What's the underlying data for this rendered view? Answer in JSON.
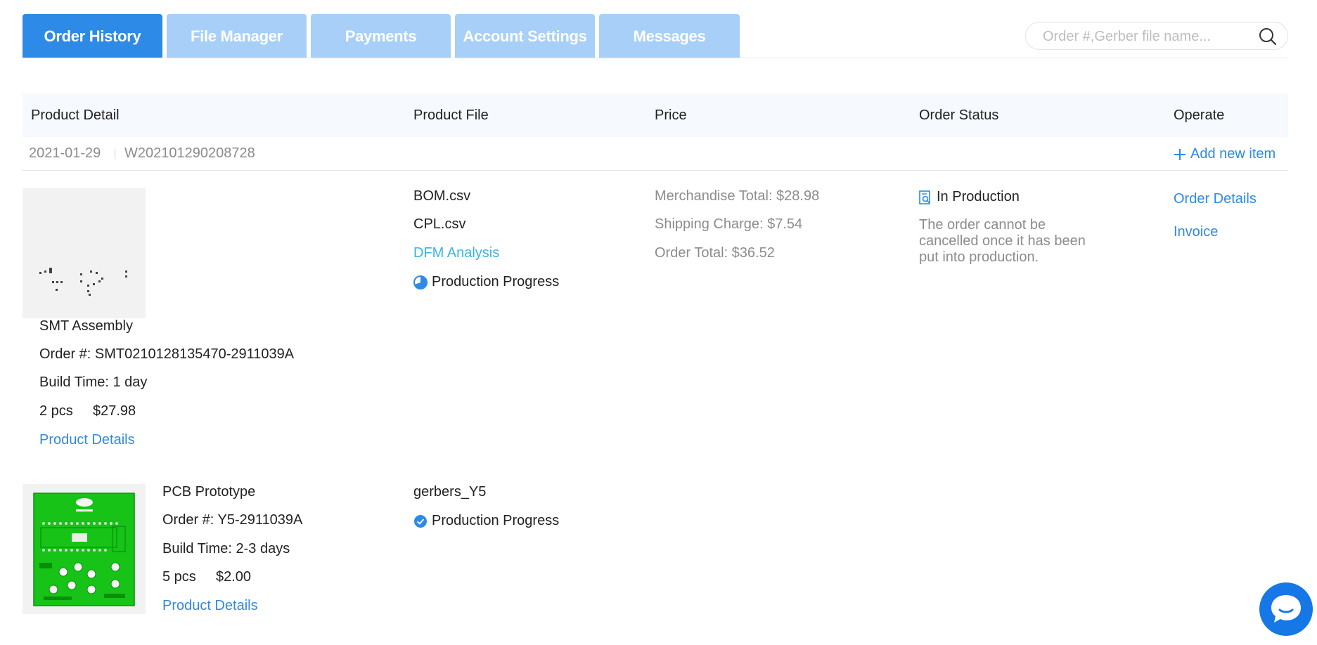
{
  "tabs": [
    {
      "label": "Order History",
      "active": true
    },
    {
      "label": "File Manager",
      "active": false
    },
    {
      "label": "Payments",
      "active": false
    },
    {
      "label": "Account Settings",
      "active": false
    },
    {
      "label": "Messages",
      "active": false
    }
  ],
  "search": {
    "placeholder": "Order #,Gerber file name...",
    "value": "",
    "icon": "search-icon"
  },
  "table": {
    "headers": {
      "product_detail": "Product Detail",
      "product_file": "Product File",
      "price": "Price",
      "order_status": "Order Status",
      "operate": "Operate"
    }
  },
  "order": {
    "date": "2021-01-29",
    "number": "W202101290208728",
    "add_new_item": "Add new item",
    "price": {
      "merchandise_total": "Merchandise Total: $28.98",
      "shipping_charge": "Shipping Charge: $7.54",
      "order_total": "Order Total: $36.52"
    },
    "status": {
      "label": "In Production",
      "note": "The order cannot be cancelled once it has been put into production."
    },
    "operate": {
      "order_details": "Order Details",
      "invoice": "Invoice"
    },
    "items": [
      {
        "name": "SMT Assembly",
        "order_no": "Order #: SMT0210128135470-2911039A",
        "build_time": "Build Time: 1 day",
        "qty": "2 pcs",
        "price": "$27.98",
        "details_link": "Product Details",
        "files": [
          "BOM.csv",
          "CPL.csv"
        ],
        "dfm": "DFM Analysis",
        "progress": "Production Progress",
        "progress_icon": "pie-progress-icon"
      },
      {
        "name": "PCB Prototype",
        "order_no": "Order #: Y5-2911039A",
        "build_time": "Build Time: 2-3 days",
        "qty": "5 pcs",
        "price": "$2.00",
        "details_link": "Product Details",
        "files": [
          "gerbers_Y5"
        ],
        "progress": "Production Progress",
        "progress_icon": "check-circle-icon"
      }
    ]
  },
  "colors": {
    "primary": "#2d8ae6",
    "tab_inactive": "#a7cff8",
    "pcb_green": "#16c316",
    "chat": "#1677e6"
  },
  "chat": {
    "icon": "chat-bubble-icon"
  }
}
